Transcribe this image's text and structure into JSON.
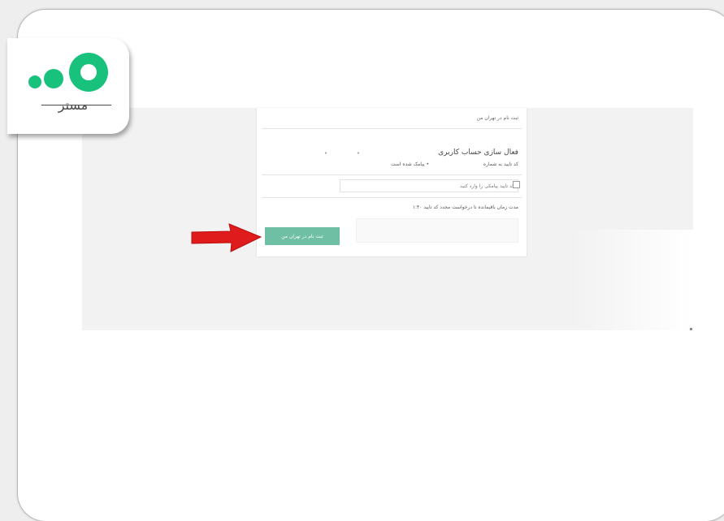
{
  "logo": {
    "text": "مستر"
  },
  "form": {
    "header_title": "ثبت نام در تهران من",
    "section_title": "فعال سازی حساب کاربری",
    "verification_label": "کد تایید به شماره",
    "sms_sent_text": "• پیامک شده است",
    "code_input_placeholder": "کد تایید پیامکی را وارد کنید",
    "countdown_text": "مدت زمان باقیمانده تا درخواست مجدد کد تایید ۱:۴۰",
    "submit_label": "ثبت نام در تهران من"
  },
  "colors": {
    "accent": "#6fbfa5",
    "logo_green": "#18c27d",
    "arrow_red": "#e01b1b"
  },
  "icons": {
    "arrow": "right-arrow-icon",
    "logo": "three-dots-logo-icon"
  }
}
